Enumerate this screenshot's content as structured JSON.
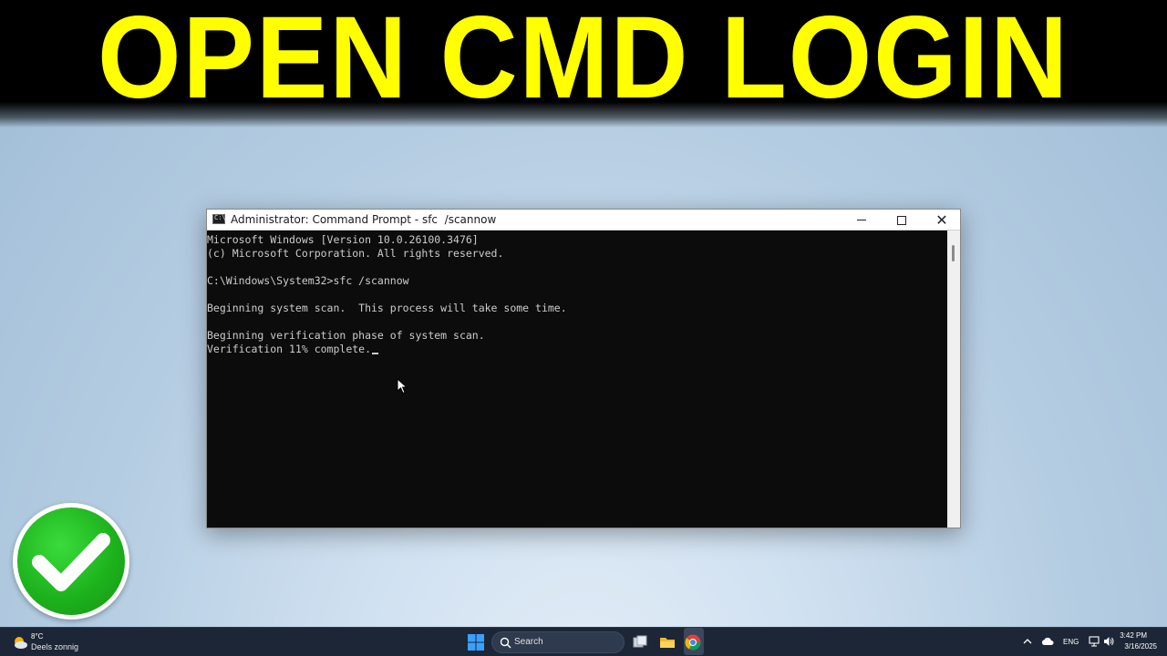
{
  "banner": {
    "title": "OPEN CMD LOGIN"
  },
  "cmd_window": {
    "title": "Administrator: Command Prompt - sfc  /scannow",
    "console_lines": [
      "Microsoft Windows [Version 10.0.26100.3476]",
      "(c) Microsoft Corporation. All rights reserved.",
      "",
      "C:\\Windows\\System32>sfc /scannow",
      "",
      "Beginning system scan.  This process will take some time.",
      "",
      "Beginning verification phase of system scan.",
      "Verification 11% complete."
    ]
  },
  "taskbar": {
    "weather": {
      "temp": "8°C",
      "desc": "Deels zonnig"
    },
    "search_label": "Search",
    "language": "ENG",
    "clock_time": "3:42 PM",
    "clock_date": "3/16/2025"
  },
  "colors": {
    "banner_text": "#ffff00",
    "console_bg": "#0c0c0c",
    "console_text": "#cccccc",
    "check_green": "#1db31d",
    "taskbar_bg": "#1c2636"
  }
}
